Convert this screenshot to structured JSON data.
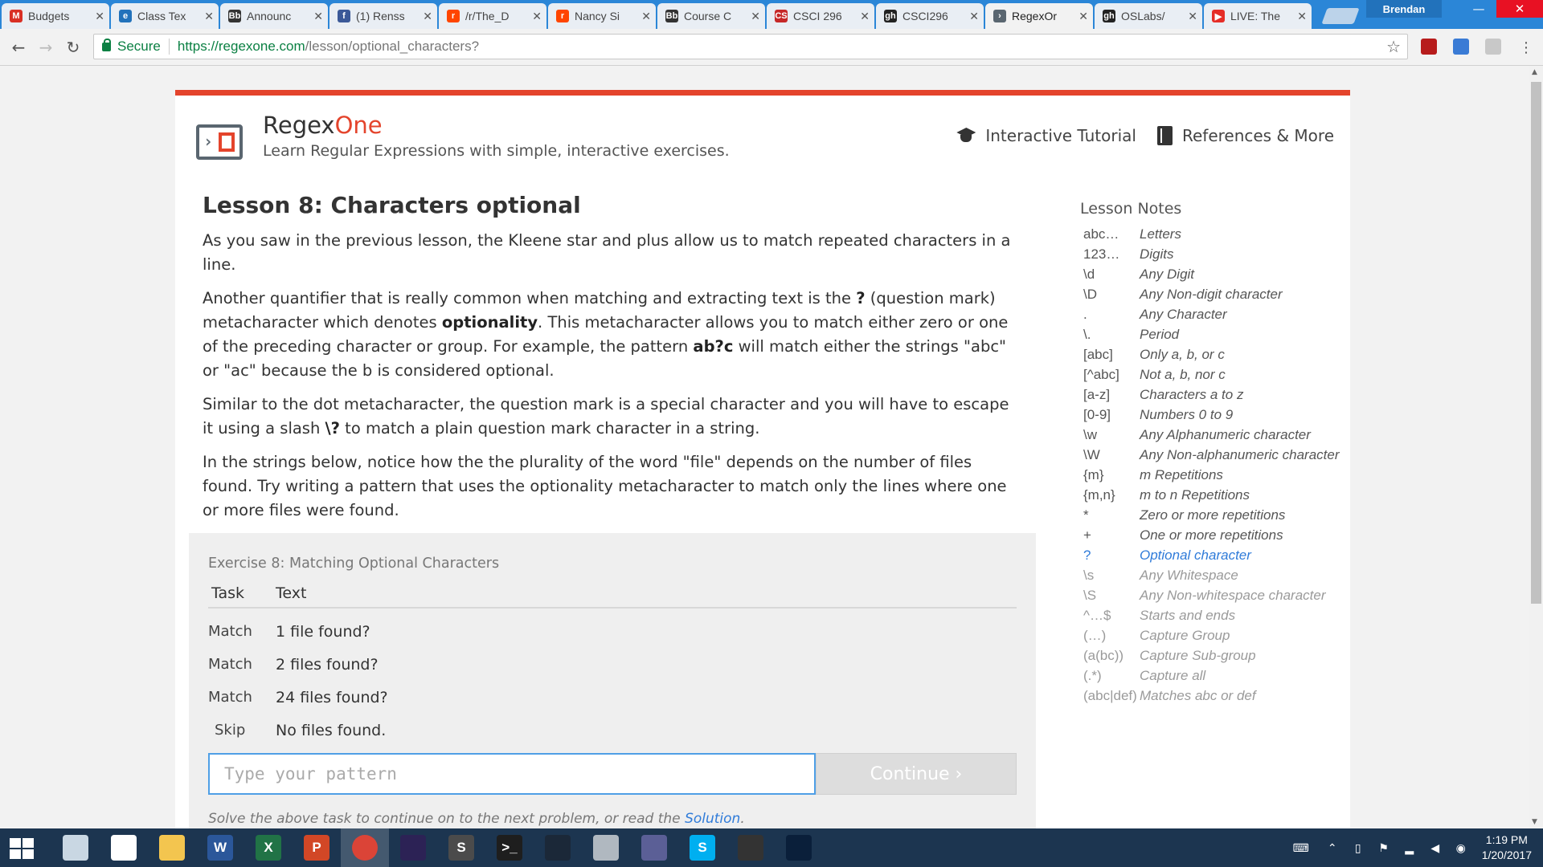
{
  "browser": {
    "tabs": [
      {
        "title": "Budgets",
        "icon": "gmail-icon",
        "color": "#d93025",
        "glyph": "M",
        "active": false
      },
      {
        "title": "Class Tex",
        "icon": "page-icon",
        "color": "#2272bb",
        "glyph": "e",
        "active": false
      },
      {
        "title": "Announc",
        "icon": "blackboard-icon",
        "color": "#333333",
        "glyph": "Bb",
        "active": false
      },
      {
        "title": "(1) Renss",
        "icon": "facebook-icon",
        "color": "#3b5998",
        "glyph": "f",
        "active": false
      },
      {
        "title": "/r/The_D",
        "icon": "reddit-icon",
        "color": "#ff4500",
        "glyph": "r",
        "active": false
      },
      {
        "title": "Nancy Si",
        "icon": "reddit-icon",
        "color": "#ff4500",
        "glyph": "r",
        "active": false
      },
      {
        "title": "Course C",
        "icon": "blackboard-icon",
        "color": "#333333",
        "glyph": "Bb",
        "active": false
      },
      {
        "title": "CSCI 296",
        "icon": "cs-icon",
        "color": "#c62828",
        "glyph": "CS",
        "active": false
      },
      {
        "title": "CSCI296",
        "icon": "github-icon",
        "color": "#222222",
        "glyph": "gh",
        "active": false
      },
      {
        "title": "RegexOr",
        "icon": "regexone-icon",
        "color": "#5a6670",
        "glyph": "›",
        "active": true
      },
      {
        "title": "OSLabs/",
        "icon": "github-icon",
        "color": "#222222",
        "glyph": "gh",
        "active": false
      },
      {
        "title": "LIVE: The",
        "icon": "youtube-icon",
        "color": "#e52d27",
        "glyph": "▶",
        "active": false
      }
    ],
    "profile_name": "Brendan",
    "secure_label": "Secure",
    "url_host": "https://regexone.com",
    "url_path": "/lesson/optional_characters?"
  },
  "site": {
    "brand_part1": "Regex",
    "brand_part2": "One",
    "tagline": "Learn Regular Expressions with simple, interactive exercises.",
    "nav": {
      "tutorial": "Interactive Tutorial",
      "references": "References & More"
    }
  },
  "lesson": {
    "title": "Lesson 8: Characters optional",
    "p1": "As you saw in the previous lesson, the Kleene star and plus allow us to match repeated characters in a line.",
    "p2_a": "Another quantifier that is really common when matching and extracting text is the ",
    "p2_b": "?",
    "p2_c": " (question mark) metacharacter which denotes ",
    "p2_d": "optionality",
    "p2_e": ". This metacharacter allows you to match either zero or one of the preceding character or group. For example, the pattern ",
    "p2_f": "ab?c",
    "p2_g": " will match either the strings \"abc\" or \"ac\" because the b is considered optional.",
    "p3_a": "Similar to the dot metacharacter, the question mark is a special character and you will have to escape it using a slash ",
    "p3_b": "\\?",
    "p3_c": " to match a plain question mark character in a string.",
    "p4": "In the strings below, notice how the the plurality of the word \"file\" depends on the number of files found. Try writing a pattern that uses the optionality metacharacter to match only the lines where one or more files were found."
  },
  "exercise": {
    "title": "Exercise 8: Matching Optional Characters",
    "col_task": "Task",
    "col_text": "Text",
    "rows": [
      {
        "task": "Match",
        "text": "1 file found?"
      },
      {
        "task": "Match",
        "text": "2 files found?"
      },
      {
        "task": "Match",
        "text": "24 files found?"
      },
      {
        "task": "Skip",
        "text": "No files found."
      }
    ],
    "input_value": "",
    "input_placeholder": "Type your pattern",
    "continue_label": "Continue ›",
    "footer_prefix": "Solve the above task to continue on to the next problem, or read the ",
    "footer_link": "Solution",
    "footer_suffix": "."
  },
  "notes": {
    "title": "Lesson Notes",
    "items": [
      {
        "sym": "abc…",
        "desc": "Letters",
        "state": "done"
      },
      {
        "sym": "123…",
        "desc": "Digits",
        "state": "done"
      },
      {
        "sym": "\\d",
        "desc": "Any Digit",
        "state": "done"
      },
      {
        "sym": "\\D",
        "desc": "Any Non-digit character",
        "state": "done"
      },
      {
        "sym": ".",
        "desc": "Any Character",
        "state": "done"
      },
      {
        "sym": "\\.",
        "desc": "Period",
        "state": "done"
      },
      {
        "sym": "[abc]",
        "desc": "Only a, b, or c",
        "state": "done"
      },
      {
        "sym": "[^abc]",
        "desc": "Not a, b, nor c",
        "state": "done"
      },
      {
        "sym": "[a-z]",
        "desc": "Characters a to z",
        "state": "done"
      },
      {
        "sym": "[0-9]",
        "desc": "Numbers 0 to 9",
        "state": "done"
      },
      {
        "sym": "\\w",
        "desc": "Any Alphanumeric character",
        "state": "done"
      },
      {
        "sym": "\\W",
        "desc": "Any Non-alphanumeric character",
        "state": "done"
      },
      {
        "sym": "{m}",
        "desc": "m Repetitions",
        "state": "done"
      },
      {
        "sym": "{m,n}",
        "desc": "m to n Repetitions",
        "state": "done"
      },
      {
        "sym": "*",
        "desc": "Zero or more repetitions",
        "state": "done"
      },
      {
        "sym": "+",
        "desc": "One or more repetitions",
        "state": "done"
      },
      {
        "sym": "?",
        "desc": "Optional character",
        "state": "current"
      },
      {
        "sym": "\\s",
        "desc": "Any Whitespace",
        "state": "upcoming"
      },
      {
        "sym": "\\S",
        "desc": "Any Non-whitespace character",
        "state": "upcoming"
      },
      {
        "sym": "^…$",
        "desc": "Starts and ends",
        "state": "upcoming"
      },
      {
        "sym": "(…)",
        "desc": "Capture Group",
        "state": "upcoming"
      },
      {
        "sym": "(a(bc))",
        "desc": "Capture Sub-group",
        "state": "upcoming"
      },
      {
        "sym": "(.*)",
        "desc": "Capture all",
        "state": "upcoming"
      },
      {
        "sym": "(abc|def)",
        "desc": "Matches abc or def",
        "state": "upcoming"
      }
    ]
  },
  "taskbar": {
    "apps": [
      {
        "name": "firefox-icon",
        "color": "#c9d7e3",
        "glyph": ""
      },
      {
        "name": "file-icon",
        "color": "#ffffff",
        "glyph": ""
      },
      {
        "name": "file-explorer-icon",
        "color": "#f3c54f",
        "glyph": ""
      },
      {
        "name": "word-icon",
        "color": "#2b579a",
        "glyph": "W"
      },
      {
        "name": "excel-icon",
        "color": "#217346",
        "glyph": "X"
      },
      {
        "name": "powerpoint-icon",
        "color": "#d24726",
        "glyph": "P"
      },
      {
        "name": "chrome-icon",
        "color": "#db4437",
        "glyph": ""
      },
      {
        "name": "eclipse-icon",
        "color": "#2c2255",
        "glyph": ""
      },
      {
        "name": "sublime-text-icon",
        "color": "#4b4b4b",
        "glyph": "S"
      },
      {
        "name": "terminal-icon",
        "color": "#1e1e1e",
        "glyph": ">_"
      },
      {
        "name": "steam-icon",
        "color": "#1b2838",
        "glyph": ""
      },
      {
        "name": "calculator-icon",
        "color": "#b0b8c0",
        "glyph": ""
      },
      {
        "name": "bittorrent-icon",
        "color": "#5b5f96",
        "glyph": ""
      },
      {
        "name": "skype-icon",
        "color": "#00aff0",
        "glyph": "S"
      },
      {
        "name": "dosbox-icon",
        "color": "#333333",
        "glyph": ""
      },
      {
        "name": "blender-icon",
        "color": "#0a1f3a",
        "glyph": ""
      }
    ],
    "time": "1:19 PM",
    "date": "1/20/2017"
  }
}
